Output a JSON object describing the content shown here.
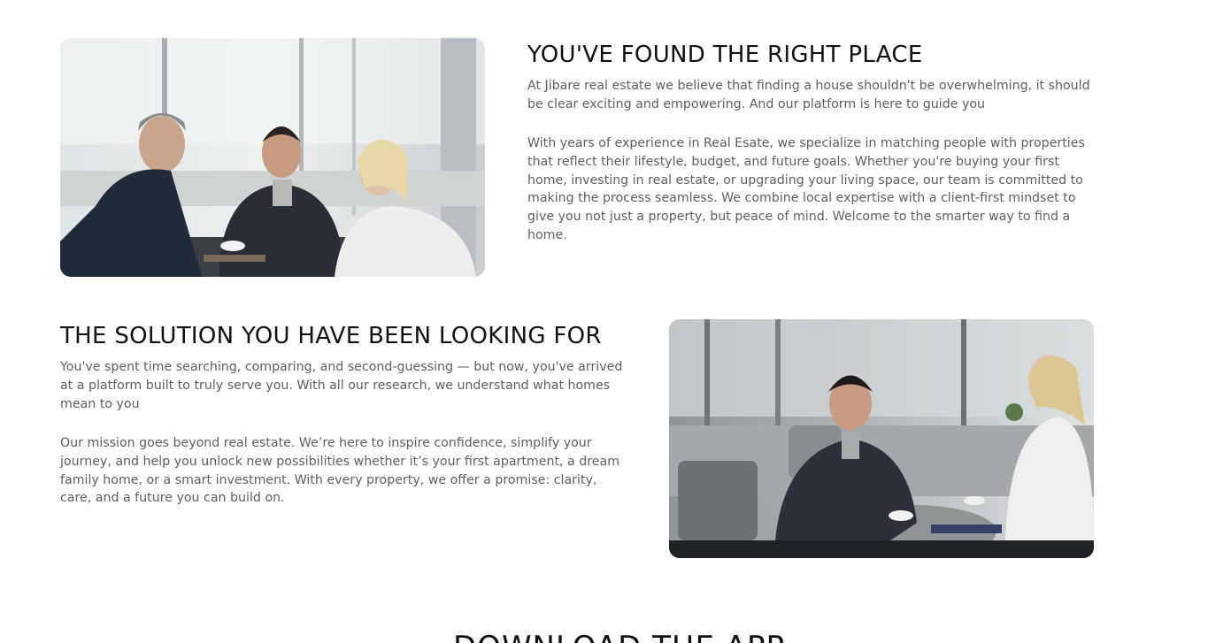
{
  "section_found": {
    "title": "YOU'VE FOUND THE RIGHT PLACE",
    "intro": "At Jibare real estate we believe that finding a house shouldn't be overwhelming, it should be clear exciting and empowering. And our platform is here to guide you",
    "body": "With years of experience in Real Esate, we specialize in matching people with properties that reflect their lifestyle, budget, and future goals. Whether you're buying your first home, investing in real estate, or upgrading your living space, our team is committed to making the process seamless. We combine local expertise with a client-first mindset to give you not just a property, but peace of mind. Welcome to the smarter way to find a home."
  },
  "section_solution": {
    "title": "THE SOLUTION YOU HAVE BEEN LOOKING FOR",
    "intro": "You've spent time searching, comparing, and second-guessing — but now, you've arrived at a platform built to truly serve you. With all our research, we understand what homes mean to you",
    "body": "Our mission goes beyond real estate. We’re here to inspire confidence, simplify your journey, and help you unlock new possibilities whether it’s your first apartment, a dream family home, or a smart investment. With every property, we offer a promise: clarity, care, and a future you can build on."
  },
  "section_app": {
    "title": "DOWNLOAD THE APP"
  },
  "colors": {
    "heading": "#111111",
    "body_text": "#5f5f5f",
    "background": "#ffffff"
  }
}
